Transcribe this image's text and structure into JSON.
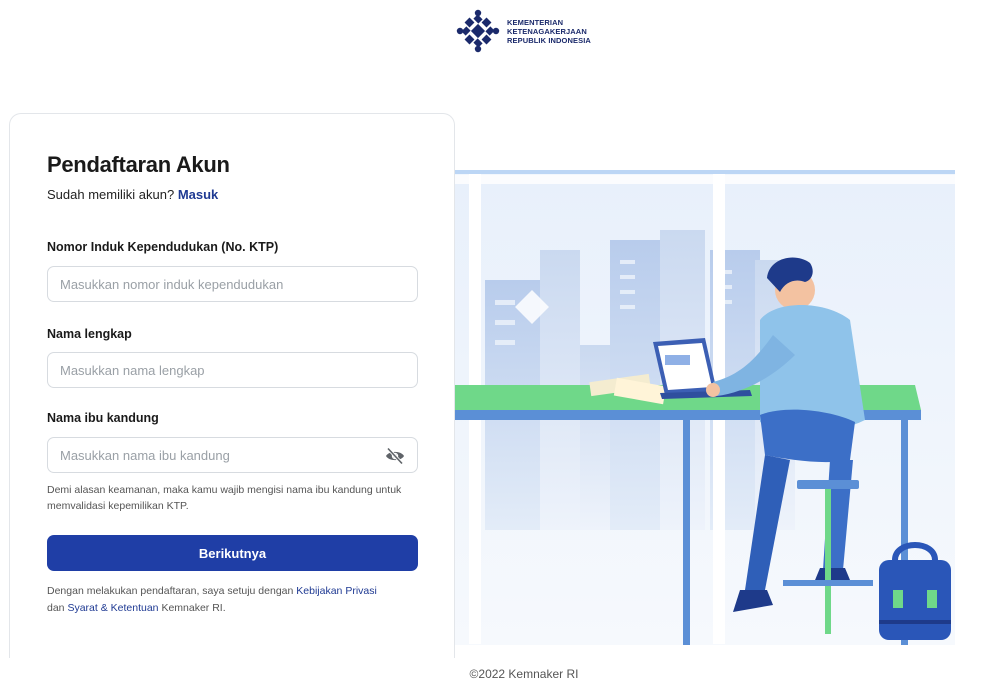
{
  "logo": {
    "line1": "KEMENTERIAN",
    "line2": "KETENAGAKERJAAN",
    "line3": "REPUBLIK INDONESIA"
  },
  "form": {
    "title": "Pendaftaran Akun",
    "subtitle_prefix": "Sudah memiliki akun?",
    "login_link": "Masuk",
    "fields": [
      {
        "label": "Nomor Induk Kependudukan (No. KTP)",
        "placeholder": "Masukkan nomor induk kependudukan",
        "value": ""
      },
      {
        "label": "Nama lengkap",
        "placeholder": "Masukkan nama lengkap",
        "value": ""
      },
      {
        "label": "Nama ibu kandung",
        "placeholder": "Masukkan nama ibu kandung",
        "value": ""
      }
    ],
    "mother_name_hint": "Demi alasan keamanan, maka kamu wajib mengisi nama ibu kandung untuk memvalidasi kepemilikan KTP.",
    "submit_label": "Berikutnya",
    "terms": {
      "part1": "Dengan melakukan pendaftaran, saya setuju dengan",
      "privacy_link": "Kebijakan Privasi",
      "part2": "dan",
      "terms_link": "Syarat & Ketentuan",
      "part3": "Kemnaker RI."
    }
  },
  "footer": {
    "copyright": "©2022 Kemnaker RI"
  },
  "colors": {
    "primary": "#1f3ea6",
    "link": "#1f3a93",
    "brand_navy": "#1b2a6b"
  }
}
